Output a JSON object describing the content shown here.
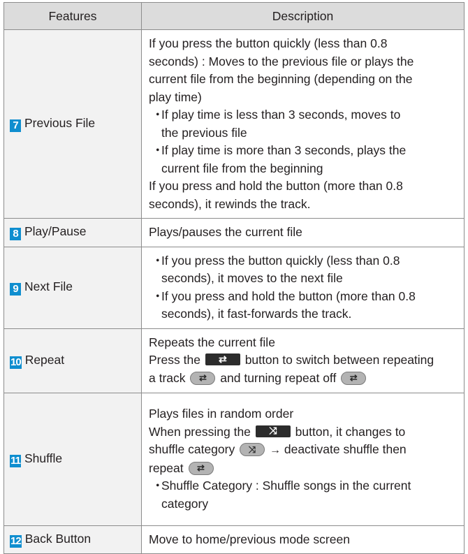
{
  "header": {
    "features": "Features",
    "description": "Description"
  },
  "rows": [
    {
      "num": "7",
      "feature": "Previous File",
      "lines": [
        "If you press the button quickly (less than 0.8",
        "seconds) : Moves to the previous file or plays the",
        "current file from the beginning (depending on the",
        "play time)"
      ],
      "bullets": [
        [
          "If play time is less than 3 seconds, moves to",
          "the previous file"
        ],
        [
          "If play time is more than 3 seconds, plays the",
          "current file from the beginning"
        ]
      ],
      "after": [
        "If you press and hold the button (more than 0.8",
        "seconds), it rewinds the track."
      ]
    },
    {
      "num": "8",
      "feature": "Play/Pause",
      "lines": [
        "Plays/pauses the current file"
      ]
    },
    {
      "num": "9",
      "feature": "Next File",
      "bullets": [
        [
          "If you press the button quickly (less than 0.8",
          "seconds), it moves to the next file"
        ],
        [
          "If you press and hold the button (more than 0.8",
          "seconds), it fast-forwards the track."
        ]
      ]
    },
    {
      "num": "10",
      "feature": "Repeat",
      "line1": "Repeats the current file",
      "line2_a": "Press the",
      "line2_b": "button to switch between repeating",
      "line3_a": "a track",
      "line3_b": "and turning repeat off"
    },
    {
      "num": "11",
      "feature": "Shuffle",
      "line1": "Plays files in random order",
      "line2_a": "When pressing the",
      "line2_b": "button, it changes to",
      "line3_a": "shuffle category",
      "line3_arrow": "→",
      "line3_b": "deactivate shuffle then",
      "line4_a": "repeat",
      "bullet": [
        "Shuffle Category : Shuffle songs in the current",
        "category"
      ]
    },
    {
      "num": "12",
      "feature": "Back Button",
      "lines": [
        "Move to home/previous mode screen"
      ]
    }
  ],
  "bullet_char": "・",
  "icons": {
    "repeat_button": "repeat-icon",
    "repeat_track": "repeat-one-icon",
    "repeat_off": "repeat-off-icon",
    "shuffle_button": "shuffle-icon",
    "shuffle_category": "shuffle-category-icon"
  },
  "colors": {
    "number_badge": "#0f8ecf",
    "header_bg": "#dcdcdc",
    "feature_bg": "#f2f2f2"
  }
}
